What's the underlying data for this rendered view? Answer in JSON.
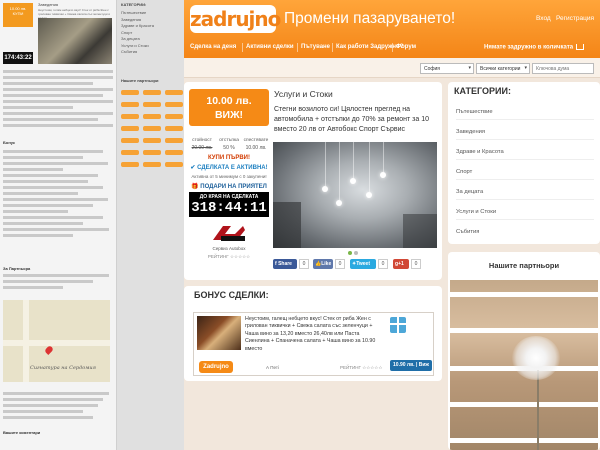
{
  "background_page": {
    "price": "10.00 лв.",
    "buy": "КУПИ",
    "title": "Заведения",
    "desc": "Неустоим, голям небцето вкус! Стек от риба Жен с грилован тиквички + Свежа салата със зеленчуци и вафли",
    "timer": "174:43:22",
    "categories_heading": "КАТЕГОРИИ:",
    "categories": [
      "Пътешествие",
      "Заведения",
      "Здраве и Красота",
      "Спорт",
      "За децата",
      "Услуги и Стоки",
      "Събития"
    ],
    "partners_heading": "Нашите партньори",
    "bonus_heading": "Бонус",
    "place_heading": "За Партньора",
    "map_signature": "Сигнатура на Сердомия",
    "footer_heading": "Вашите коментари"
  },
  "header": {
    "logo": "zadrujno",
    "slogan": "Промени пазаруването!",
    "login": "Вход",
    "register": "Регистрация"
  },
  "nav": {
    "items": [
      "Сделка на деня",
      "Активни сделки",
      "Пътуване",
      "Как работи Задружно?",
      "Форум"
    ],
    "cart": "Нямате задружно в количката"
  },
  "filters": {
    "city": "София",
    "category": "Всички категории",
    "search_placeholder": "Ключова дума"
  },
  "deal": {
    "price": "10.00 лв.",
    "buy": "ВИЖ!",
    "category": "Услуги и Стоки",
    "description": "Стегни возилото си! Цялостен преглед на автомобила + отстъпки до 70% за ремонт за 10 вместо 20 лв от Автобокс Спорт Сървис",
    "stats": {
      "headers": [
        "стойност",
        "отстъпка",
        "спестявате"
      ],
      "values": [
        "20.00 лв.",
        "50 %",
        "10.00 лв."
      ]
    },
    "buy_first": "КУПИ ПЪРВИ!",
    "deal_active": "СДЕЛКАТА Е АКТИВНА!",
    "active_with": "Активна от 5 минимум с 0 закупени!",
    "gift": "ПОДАРИ НА ПРИЯТЕЛ",
    "ends_label": "ДО КРАЯ НА СДЕЛКАТА ОСТАВАТ:",
    "timer": "318:44:11",
    "seller": "Сервиз Autobox",
    "rating_label": "РЕЙТИНГ",
    "share": {
      "facebook": "Share",
      "facebook_count": "0",
      "like": "Like",
      "like_count": "0",
      "tweet": "Tweet",
      "tweet_count": "0",
      "gplus": "+1",
      "gplus_count": "0"
    }
  },
  "bonus": {
    "title": "БОНУС СДЕЛКИ:",
    "description": "Неустоим, галещ небцето вкус! Стек от риба Жен с грилован тиквички + Свежа салата със зеленчуци + Чаша вино за 13,20 вместо 26,40лв или Паста Сиенлина + Спаначена салата + Чаша вино за 10.90 вместо",
    "logo": "Zadrujno",
    "seller": "А Петі",
    "rating_label": "РЕЙТИНГ",
    "button": "10.90 лв. | Виж"
  },
  "categories": {
    "title": "КАТЕГОРИИ:",
    "items": [
      "Пътешествие",
      "Заведения",
      "Здраве и Красота",
      "Спорт",
      "За децата",
      "Услуги и Стоки",
      "Събития"
    ]
  },
  "partners": {
    "title": "Нашите партньори"
  },
  "colors": {
    "orange": "#f48517",
    "blue_button": "#1f6ea8",
    "facebook": "#3b5998",
    "twitter": "#2aa9e0",
    "gplus": "#d14836"
  }
}
